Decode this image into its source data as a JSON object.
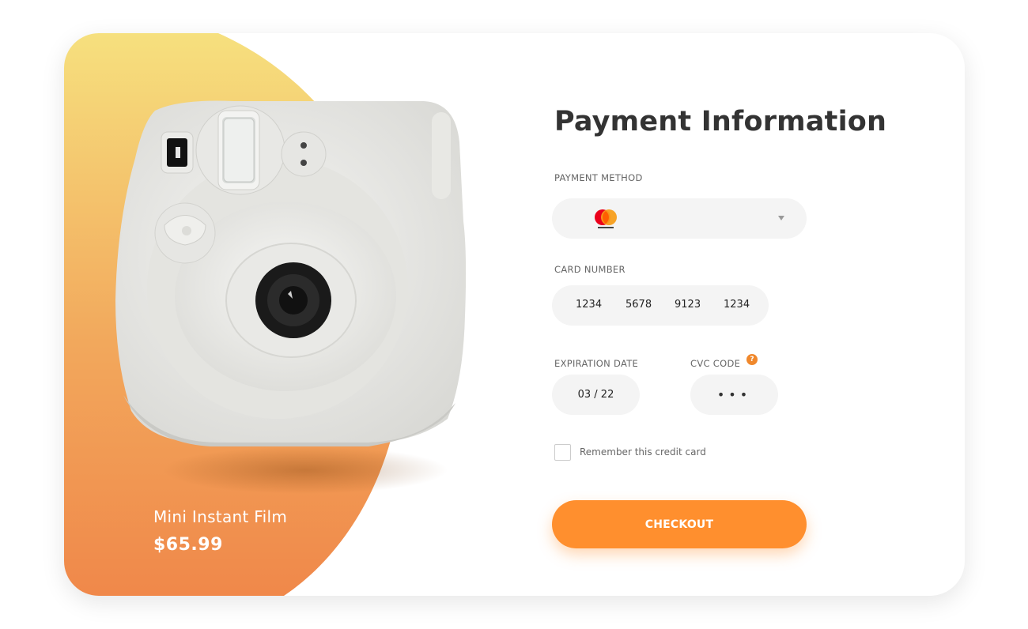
{
  "product": {
    "name": "Mini Instant Film",
    "price": "$65.99"
  },
  "payment": {
    "title": "Payment Information",
    "method_label": "PAYMENT METHOD",
    "method_selected": "mastercard",
    "card_number_label": "CARD NUMBER",
    "card_number_groups": [
      "1234",
      "5678",
      "9123",
      "1234"
    ],
    "expiration_label": "EXPIRATION DATE",
    "expiration_value": "03 / 22",
    "cvc_label": "CVC CODE",
    "cvc_value": "•••",
    "cvc_help": "?",
    "remember_label": "Remember this credit card",
    "remember_checked": false,
    "checkout_label": "CHECKOUT"
  },
  "colors": {
    "accent": "#ff8f2e",
    "gradient_top": "#f6e07e",
    "gradient_bottom": "#f0884a",
    "mc_red": "#eb001b",
    "mc_orange": "#f79e1b"
  },
  "icons": [
    "camera-image",
    "mastercard-icon",
    "chevron-down-icon",
    "help-icon",
    "checkbox-icon"
  ]
}
